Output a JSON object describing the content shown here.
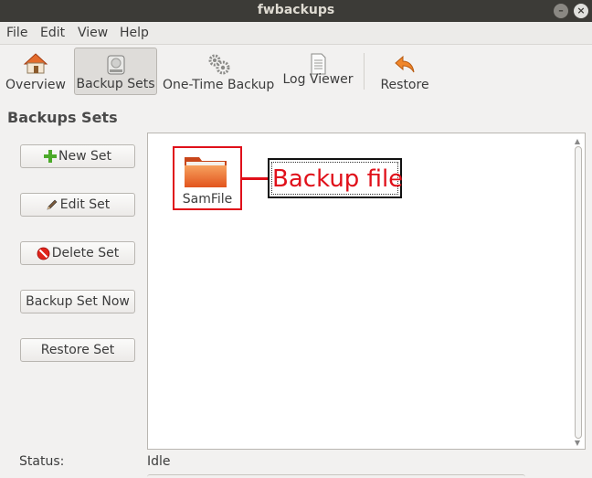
{
  "window": {
    "title": "fwbackups"
  },
  "menu": [
    "File",
    "Edit",
    "View",
    "Help"
  ],
  "toolbar": [
    {
      "label": "Overview",
      "icon": "home-icon"
    },
    {
      "label": "Backup Sets",
      "icon": "drive-icon",
      "active": true
    },
    {
      "label": "One-Time Backup",
      "icon": "gears-icon"
    },
    {
      "label": "Log Viewer",
      "icon": "document-icon"
    },
    {
      "label": "Restore",
      "icon": "restore-arrow-icon"
    }
  ],
  "section_title": "Backups Sets",
  "sidebar": {
    "new_set": "New Set",
    "edit_set": "Edit Set",
    "delete_set": "Delete Set",
    "backup_set_now": "Backup Set Now",
    "restore_set": "Restore Set"
  },
  "sets": [
    {
      "name": "SamFile",
      "icon": "folder-icon"
    }
  ],
  "annotation": {
    "text": "Backup file",
    "color": "#e0101a"
  },
  "status": {
    "label": "Status:",
    "value": "Idle"
  },
  "colors": {
    "titlebar": "#3c3b37",
    "window_bg": "#f2f1f0",
    "folder": "#e95420",
    "annotation": "#e0101a"
  }
}
